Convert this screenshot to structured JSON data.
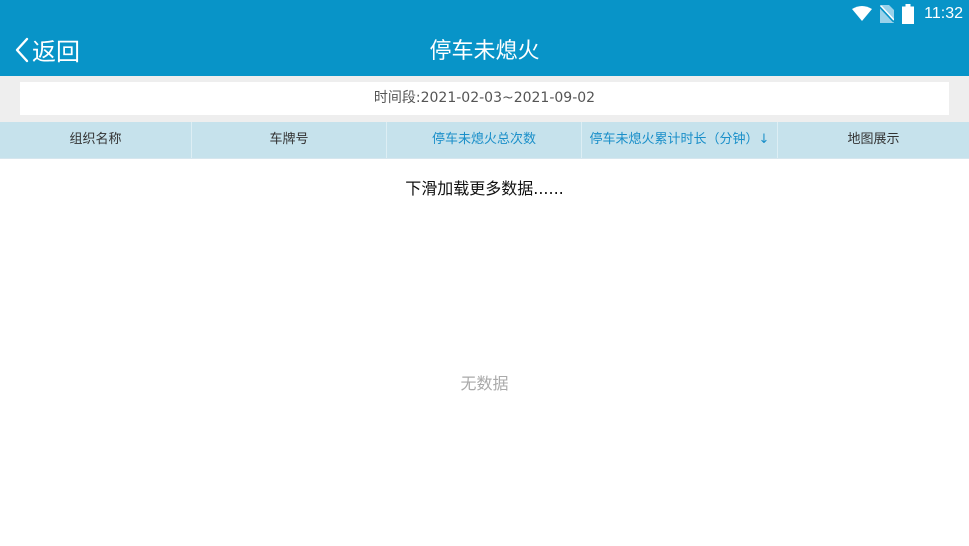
{
  "status_bar": {
    "time": "11:32",
    "icons": [
      "wifi-icon",
      "no-sim-icon",
      "battery-icon"
    ]
  },
  "header": {
    "back_label": "返回",
    "title": "停车未熄火"
  },
  "filter": {
    "date_range": "时间段:2021-02-03~2021-09-02"
  },
  "table": {
    "columns": [
      {
        "label": "组织名称",
        "active": false
      },
      {
        "label": "车牌号",
        "active": false
      },
      {
        "label": "停车未熄火总次数",
        "active": true
      },
      {
        "label": "停车未熄火累计时长（分钟）↓",
        "active": true
      },
      {
        "label": "地图展示",
        "active": false
      }
    ],
    "rows": []
  },
  "load_more_text": "下滑加载更多数据......",
  "empty_text": "无数据",
  "colors": {
    "primary": "#0894c8",
    "header_row_bg": "#c6e2ec",
    "active_header_text": "#1a8fc9",
    "empty_text": "#aaaaaa"
  }
}
